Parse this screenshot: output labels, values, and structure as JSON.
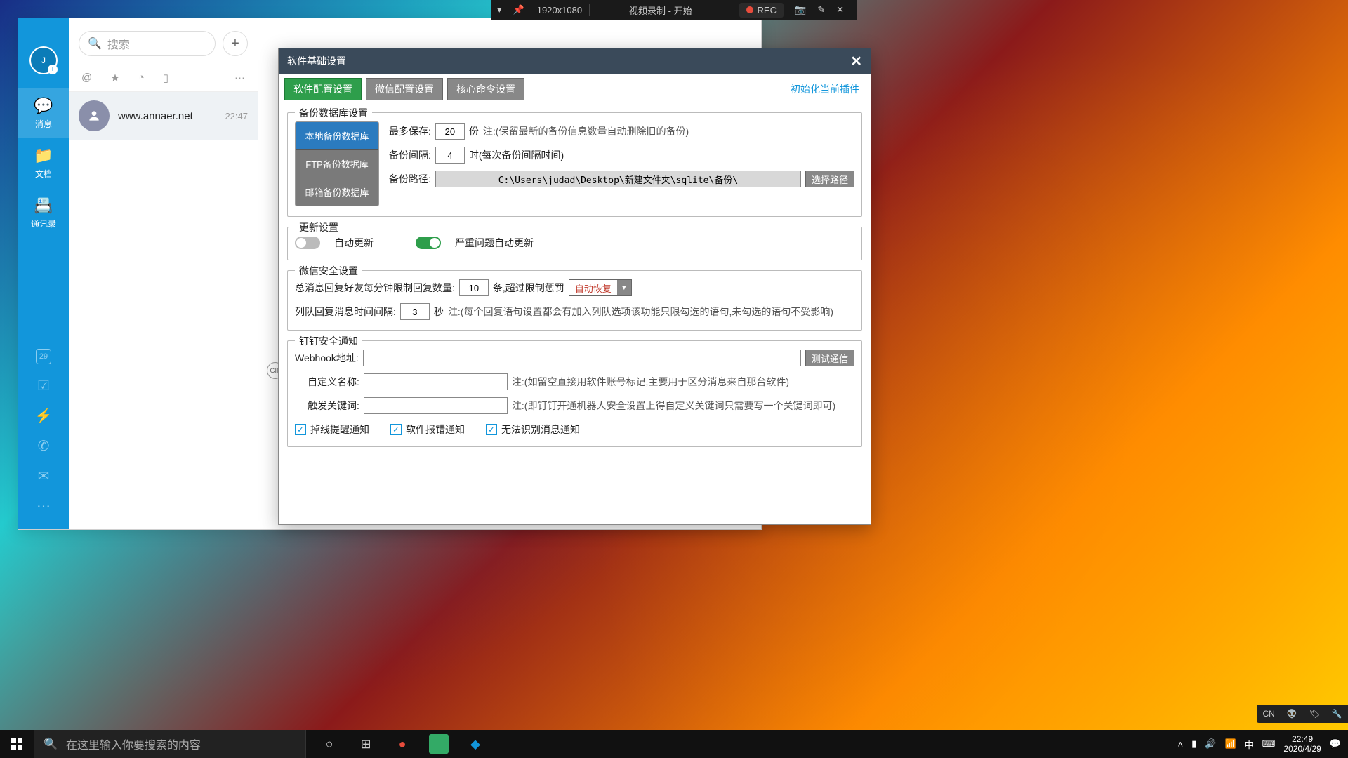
{
  "rec_toolbar": {
    "resolution": "1920x1080",
    "status": "视频录制 - 开始",
    "rec_label": "REC"
  },
  "chat_app": {
    "search_placeholder": "搜索",
    "sidebar": {
      "avatar_initial": "J",
      "items": [
        {
          "icon": "💬",
          "label": "消息"
        },
        {
          "icon": "📁",
          "label": "文档"
        },
        {
          "icon": "📇",
          "label": "通讯录"
        }
      ],
      "calendar_day": "29"
    },
    "conversation": {
      "name": "www.annaer.net",
      "time": "22:47"
    },
    "gif_label": "GIF"
  },
  "settings": {
    "title": "软件基础设置",
    "tabs": [
      "软件配置设置",
      "微信配置设置",
      "核心命令设置"
    ],
    "init_link": "初始化当前插件",
    "backup": {
      "legend": "备份数据库设置",
      "db_tabs": [
        "本地备份数据库",
        "FTP备份数据库",
        "邮箱备份数据库"
      ],
      "max_keep_label": "最多保存:",
      "max_keep_value": "20",
      "max_keep_unit": "份",
      "max_keep_hint": "注:(保留最新的备份信息数量自动删除旧的备份)",
      "interval_label": "备份间隔:",
      "interval_value": "4",
      "interval_unit": "时(每次备份间隔时间)",
      "path_label": "备份路径:",
      "path_value": "C:\\Users\\judad\\Desktop\\新建文件夹\\sqlite\\备份\\",
      "browse_btn": "选择路径"
    },
    "update": {
      "legend": "更新设置",
      "auto_label": "自动更新",
      "critical_label": "严重问题自动更新"
    },
    "wechat_sec": {
      "legend": "微信安全设置",
      "rate_label": "总消息回复好友每分钟限制回复数量:",
      "rate_value": "10",
      "rate_unit": "条,超过限制惩罚",
      "penalty_value": "自动恢复",
      "queue_label": "列队回复消息时间间隔:",
      "queue_value": "3",
      "queue_unit": "秒",
      "queue_hint": "注:(每个回复语句设置都会有加入列队选项该功能只限勾选的语句,未勾选的语句不受影响)"
    },
    "dingtalk": {
      "legend": "钉钉安全通知",
      "webhook_label": "Webhook地址:",
      "test_btn": "测试通信",
      "name_label": "自定义名称:",
      "name_hint": "注:(如留空直接用软件账号标记,主要用于区分消息来自那台软件)",
      "keyword_label": "触发关键词:",
      "keyword_hint": "注:(即钉钉开通机器人安全设置上得自定义关键词只需要写一个关键词即可)",
      "checks": [
        "掉线提醒通知",
        "软件报错通知",
        "无法识别消息通知"
      ]
    }
  },
  "tray_box": {
    "ime": "CN"
  },
  "taskbar": {
    "search_placeholder": "在这里输入你要搜索的内容",
    "ime": "中",
    "time": "22:49",
    "date": "2020/4/29"
  }
}
